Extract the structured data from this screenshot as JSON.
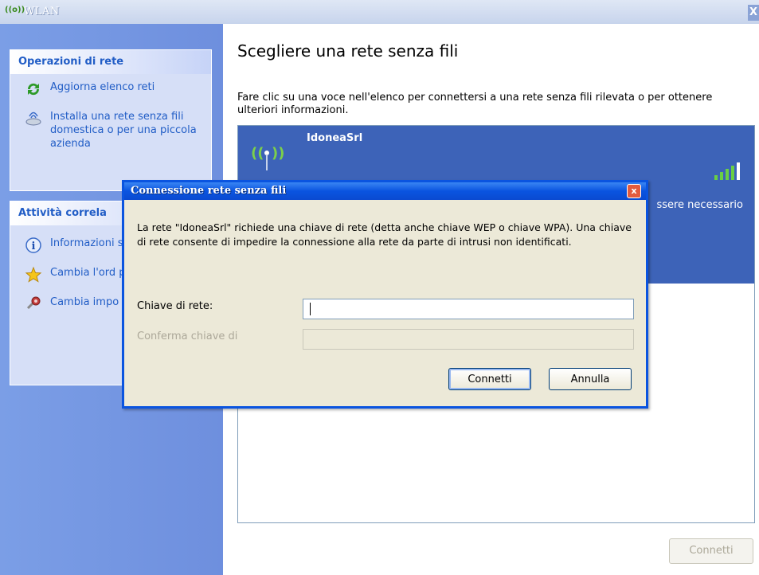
{
  "window": {
    "title": "WLAN",
    "close": "X"
  },
  "sidebar": {
    "network_tasks": {
      "header": "Operazioni di rete",
      "items": [
        {
          "label": "Aggiorna elenco reti",
          "icon": "refresh-icon"
        },
        {
          "label": "Installa una rete senza fili domestica o per una piccola azienda",
          "icon": "setup-wizard-icon"
        }
      ]
    },
    "related_tasks": {
      "header": "Attività correla",
      "items": [
        {
          "label": "Informazioni senza fili",
          "icon": "info-icon"
        },
        {
          "label": "Cambia l'ord preferite",
          "icon": "star-icon"
        },
        {
          "label": "Cambia impo avanzate",
          "icon": "settings-icon"
        }
      ]
    }
  },
  "main": {
    "heading": "Scegliere una rete senza fili",
    "description": "Fare clic su una voce nell'elenco per connettersi a una rete senza fili rilevata o per ottenere ulteriori informazioni.",
    "networks": [
      {
        "name": "IdoneaSrl",
        "partial_text": "ssere necessario",
        "signal_bars": 5
      }
    ],
    "connect_button": "Connetti"
  },
  "dialog": {
    "title": "Connessione rete senza fili",
    "close": "x",
    "message": "La rete \"IdoneaSrl\" richiede una chiave di rete (detta anche chiave WEP o chiave WPA). Una chiave di rete consente di impedire la connessione alla rete da parte di intrusi non identificati.",
    "key_label": "Chiave di rete:",
    "key_value": "",
    "confirm_label": "Conferma chiave di",
    "confirm_value": "",
    "ok_button": "Connetti",
    "cancel_button": "Annulla"
  },
  "colors": {
    "accent": "#0a54e0",
    "sidebar": "#7b9ee6",
    "selected_row": "#3d63b8",
    "link": "#215dc6"
  }
}
